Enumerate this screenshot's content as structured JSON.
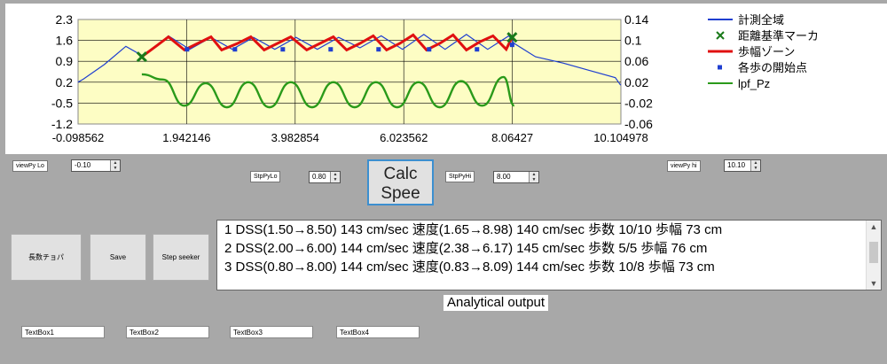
{
  "chart": {
    "legend": [
      {
        "label": "計測全域",
        "color": "#1f3fd0",
        "kind": "line"
      },
      {
        "label": "距離基準マーカ",
        "color": "#1a7a1a",
        "kind": "x"
      },
      {
        "label": "歩幅ゾーン",
        "color": "#e01010",
        "kind": "line"
      },
      {
        "label": "各歩の開始点",
        "color": "#1f3fd0",
        "kind": "dot"
      },
      {
        "label": "lpf_Pz",
        "color": "#2a9a1a",
        "kind": "line"
      }
    ],
    "x_ticks": [
      "-0.098562",
      "1.942146",
      "3.982854",
      "6.023562",
      "8.06427",
      "10.104978"
    ],
    "y_left_ticks": [
      "2.3",
      "1.6",
      "0.9",
      "0.2",
      "-0.5",
      "-1.2"
    ],
    "y_right_ticks": [
      "0.14",
      "0.1",
      "0.06",
      "0.02",
      "-0.02",
      "-0.06"
    ]
  },
  "chart_data": {
    "type": "line",
    "xlim": [
      -0.098562,
      10.104978
    ],
    "ylim_left": [
      -1.2,
      2.3
    ],
    "ylim_right": [
      -0.06,
      0.14
    ],
    "grid": true,
    "legend_position": "right",
    "series": [
      {
        "name": "計測全域",
        "axis": "left",
        "x": [
          -0.1,
          0.0,
          0.4,
          0.8,
          1.1,
          1.4,
          1.6,
          2.0,
          2.4,
          2.8,
          3.2,
          3.6,
          4.0,
          4.4,
          4.8,
          5.2,
          5.6,
          6.0,
          6.4,
          6.8,
          7.2,
          7.6,
          8.0,
          8.1,
          8.5,
          9.0,
          9.5,
          10.0,
          10.1
        ],
        "y": [
          0.2,
          0.3,
          0.8,
          1.4,
          1.1,
          1.45,
          1.75,
          1.3,
          1.7,
          1.3,
          1.7,
          1.3,
          1.7,
          1.3,
          1.7,
          1.35,
          1.75,
          1.3,
          1.8,
          1.3,
          1.8,
          1.3,
          1.75,
          1.5,
          1.05,
          0.85,
          0.6,
          0.35,
          0.1
        ]
      },
      {
        "name": "歩幅ゾーン",
        "axis": "left",
        "x": [
          1.1,
          1.4,
          1.6,
          1.9,
          2.15,
          2.4,
          2.6,
          2.9,
          3.15,
          3.4,
          3.65,
          3.9,
          4.2,
          4.45,
          4.7,
          4.95,
          5.2,
          5.45,
          5.7,
          5.95,
          6.2,
          6.45,
          6.7,
          6.95,
          7.2,
          7.45,
          7.7,
          7.95,
          8.06
        ],
        "y": [
          1.05,
          1.45,
          1.72,
          1.28,
          1.5,
          1.72,
          1.28,
          1.5,
          1.72,
          1.28,
          1.5,
          1.72,
          1.28,
          1.5,
          1.72,
          1.28,
          1.5,
          1.75,
          1.28,
          1.5,
          1.78,
          1.28,
          1.5,
          1.78,
          1.28,
          1.55,
          1.75,
          1.3,
          1.7
        ]
      },
      {
        "name": "各歩の開始点",
        "axis": "left",
        "x": [
          1.95,
          2.85,
          3.75,
          4.65,
          5.55,
          6.5,
          7.4,
          8.06
        ],
        "y": [
          1.3,
          1.3,
          1.3,
          1.3,
          1.3,
          1.3,
          1.3,
          1.45
        ]
      },
      {
        "name": "距離基準マーカ",
        "axis": "left",
        "x": [
          1.1,
          8.06
        ],
        "y": [
          1.05,
          1.7
        ]
      },
      {
        "name": "lpf_Pz",
        "axis": "right",
        "x": [
          1.1,
          1.5,
          1.9,
          2.3,
          2.7,
          3.1,
          3.5,
          3.9,
          4.3,
          4.7,
          5.1,
          5.5,
          5.9,
          6.3,
          6.7,
          7.1,
          7.5,
          7.9,
          8.1
        ],
        "y": [
          0.035,
          0.025,
          -0.025,
          0.018,
          -0.028,
          0.02,
          -0.028,
          0.02,
          -0.028,
          0.02,
          -0.028,
          0.02,
          -0.028,
          0.02,
          -0.028,
          0.022,
          -0.025,
          0.03,
          -0.025
        ]
      }
    ]
  },
  "controls": {
    "view_lo_label": "viewPy Lo",
    "view_lo_value": "-0.10",
    "stp_lo_label": "StpPyLo",
    "stp_lo_value": "0.80",
    "stp_hi_label": "StpPyHi",
    "stp_hi_value": "8.00",
    "view_hi_label": "viewPy hi",
    "view_hi_value": "10.10",
    "calc_line1": "Calc",
    "calc_line2": "Spee",
    "btn_main": "長数チョパ",
    "btn_save": "Save",
    "btn_step": "Step seeker"
  },
  "output": {
    "lines": [
      "1 DSS(1.50→8.50)  143 cm/sec  速度(1.65→8.98) 140 cm/sec 歩数 10/10 歩幅 73 cm",
      "2 DSS(2.00→6.00)  144 cm/sec  速度(2.38→6.17) 145 cm/sec 歩数 5/5 歩幅 76 cm",
      "3 DSS(0.80→8.00)  144 cm/sec  速度(0.83→8.09) 144 cm/sec 歩数 10/8 歩幅 73 cm"
    ],
    "caption": "Analytical output"
  },
  "textboxes": [
    "TextBox1",
    "TextBox2",
    "TextBox3",
    "TextBox4"
  ]
}
